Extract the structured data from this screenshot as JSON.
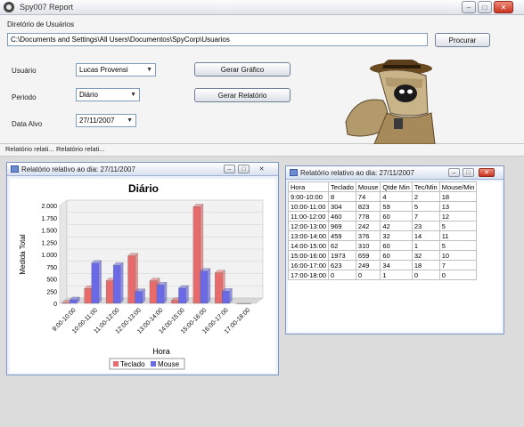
{
  "window": {
    "title": "Spy007 Report"
  },
  "dir": {
    "label": "Diretório de Usuários",
    "path": "C:\\Documents and Settings\\All Users\\Documentos\\SpyCorp\\Usuarios",
    "browse_label": "Procurar"
  },
  "form": {
    "user_label": "Usuário",
    "user_value": "Lucas Provensi",
    "period_label": "Periodo",
    "period_value": "Diário",
    "date_label": "Data Alvo",
    "date_value": "27/11/2007",
    "graph_button": "Gerar Gráfico",
    "report_button": "Gerar Relatório"
  },
  "tabs": [
    "Relatório relati...",
    "Relatório relati..."
  ],
  "chart_window": {
    "title": "Relatório relativo ao dia: 27/11/2007"
  },
  "table_window": {
    "title": "Relatório relativo ao dia: 27/11/2007"
  },
  "chart_data": {
    "type": "bar",
    "title": "Diário",
    "xlabel": "Hora",
    "ylabel": "Medida Total",
    "ylim": [
      0,
      2000
    ],
    "yticks": [
      "0",
      "250",
      "500",
      "750",
      "1.000",
      "1.250",
      "1.500",
      "1.750",
      "2.000"
    ],
    "categories": [
      "9:00-10:00",
      "10:00-11:00",
      "11:00-12:00",
      "12:00-13:00",
      "13:00-14:00",
      "14:00-15:00",
      "15:00-16:00",
      "16:00-17:00",
      "17:00-18:00"
    ],
    "series": [
      {
        "name": "Teclado",
        "color": "#e86a6a",
        "values": [
          8,
          304,
          460,
          969,
          459,
          62,
          1973,
          623,
          0
        ]
      },
      {
        "name": "Mouse",
        "color": "#6a6ae8",
        "values": [
          74,
          823,
          778,
          242,
          376,
          310,
          659,
          249,
          0
        ]
      }
    ]
  },
  "table": {
    "headers": [
      "Hora",
      "Teclado",
      "Mouse",
      "Qtde Min",
      "Tec/Min",
      "Mouse/Min"
    ],
    "rows": [
      [
        "9:00-10:00",
        "8",
        "74",
        "4",
        "2",
        "18"
      ],
      [
        "10:00-11:00",
        "304",
        "823",
        "59",
        "5",
        "13"
      ],
      [
        "11:00-12:00",
        "460",
        "778",
        "60",
        "7",
        "12"
      ],
      [
        "12:00-13:00",
        "969",
        "242",
        "42",
        "23",
        "5"
      ],
      [
        "13:00-14:00",
        "459",
        "376",
        "32",
        "14",
        "11"
      ],
      [
        "14:00-15:00",
        "62",
        "310",
        "60",
        "1",
        "5"
      ],
      [
        "15:00-16:00",
        "1973",
        "659",
        "60",
        "32",
        "10"
      ],
      [
        "16:00-17:00",
        "623",
        "249",
        "34",
        "18",
        "7"
      ],
      [
        "17:00-18:00",
        "0",
        "0",
        "1",
        "0",
        "0"
      ]
    ]
  }
}
